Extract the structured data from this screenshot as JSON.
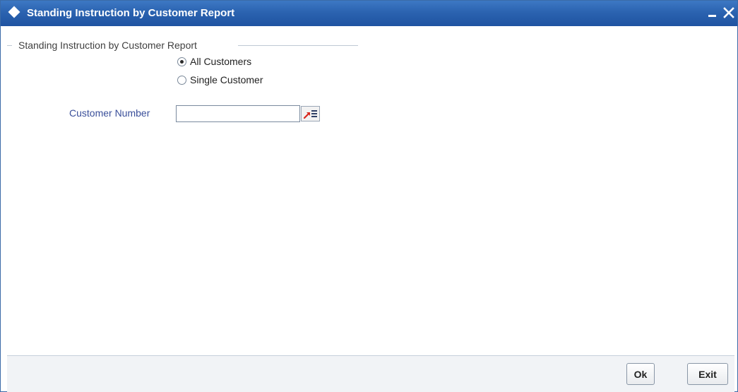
{
  "window": {
    "title": "Standing Instruction by Customer Report",
    "minimize_icon": "minimize-icon",
    "close_icon": "close-icon"
  },
  "form": {
    "section_legend": "Standing Instruction by Customer Report",
    "customer_selection": {
      "options": [
        {
          "label": "All Customers",
          "selected": true
        },
        {
          "label": "Single Customer",
          "selected": false
        }
      ]
    },
    "customer_number": {
      "label": "Customer Number",
      "value": "",
      "lov_icon": "list-of-values-icon"
    }
  },
  "footer": {
    "ok_label": "Ok",
    "exit_label": "Exit"
  },
  "colors": {
    "titlebar": "#2b63b0",
    "field_label": "#3a4f9a",
    "lov_arrow": "#d8261c"
  }
}
